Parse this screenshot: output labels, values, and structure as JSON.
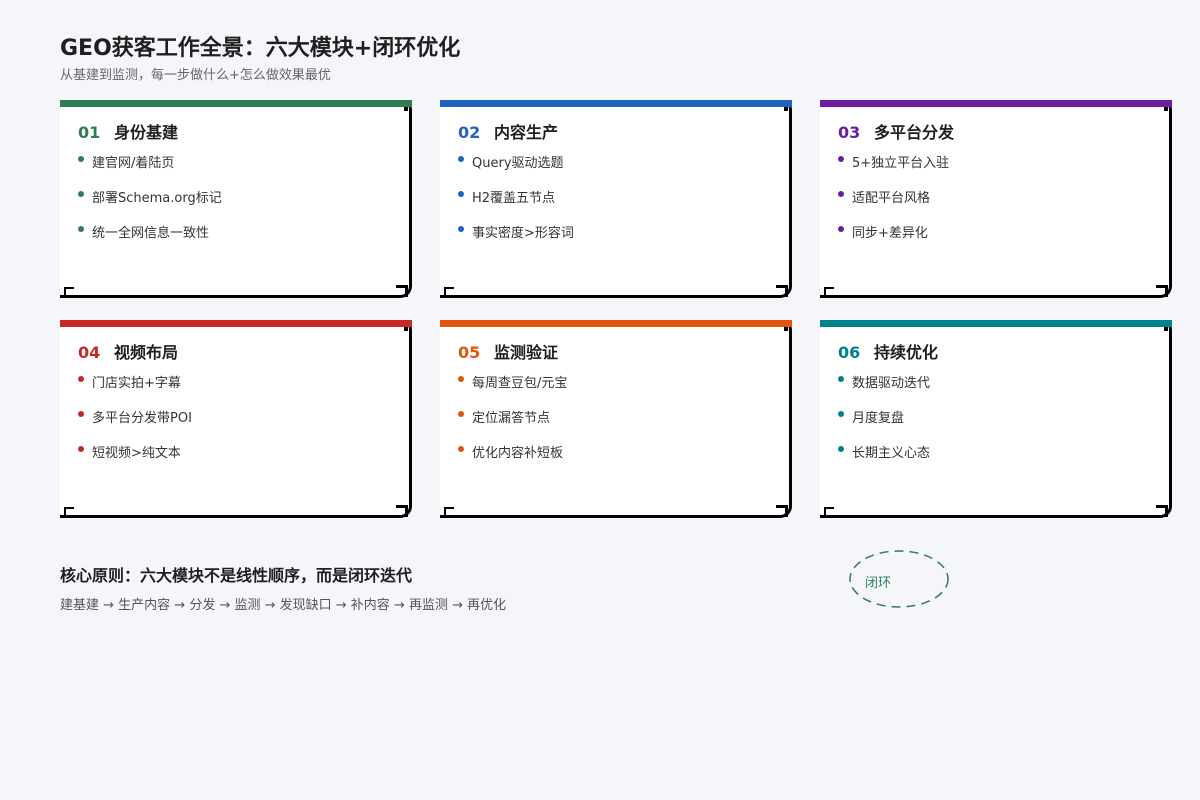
{
  "header": {
    "title": "GEO获客工作全景：六大模块+闭环优化",
    "subtitle": "从基建到监测，每一步做什么+怎么做效果最优"
  },
  "modules": [
    {
      "num": "01",
      "title": "身份基建",
      "color": "#2e7d55",
      "items": [
        "建官网/着陆页",
        "部署Schema.org标记",
        "统一全网信息一致性"
      ]
    },
    {
      "num": "02",
      "title": "内容生产",
      "color": "#1e63c4",
      "items": [
        "Query驱动选题",
        "H2覆盖五节点",
        "事实密度>形容词"
      ]
    },
    {
      "num": "03",
      "title": "多平台分发",
      "color": "#6a1fa0",
      "items": [
        "5+独立平台入驻",
        "适配平台风格",
        "同步+差异化"
      ]
    },
    {
      "num": "04",
      "title": "视频布局",
      "color": "#c62828",
      "items": [
        "门店实拍+字幕",
        "多平台分发带POI",
        "短视频>纯文本"
      ]
    },
    {
      "num": "05",
      "title": "监测验证",
      "color": "#e0560f",
      "items": [
        "每周查豆包/元宝",
        "定位漏答节点",
        "优化内容补短板"
      ]
    },
    {
      "num": "06",
      "title": "持续优化",
      "color": "#00828a",
      "items": [
        "数据驱动迭代",
        "月度复盘",
        "长期主义心态"
      ]
    }
  ],
  "footer": {
    "principle": "核心原则：六大模块不是线性顺序，而是闭环迭代",
    "flow": "建基建 → 生产内容 → 分发 → 监测 → 发现缺口 → 补内容 → 再监测 → 再优化",
    "loop_label": "闭环",
    "loop_color": "#2e7d55"
  }
}
